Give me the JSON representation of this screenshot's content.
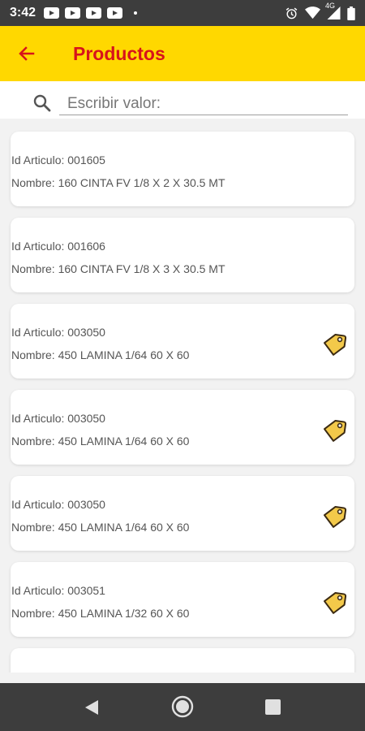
{
  "status_bar": {
    "time": "3:42",
    "network": "4G",
    "notification_icons": [
      "youtube-icon",
      "youtube-icon",
      "youtube-icon",
      "youtube-icon"
    ]
  },
  "app_bar": {
    "title": "Productos",
    "background_color": "#ffd800",
    "title_color": "#d7141b"
  },
  "search": {
    "placeholder": "Escribir valor:",
    "value": ""
  },
  "products": [
    {
      "id_label": "Id Articulo:  001605",
      "name_label": "Nombre: 160 CINTA FV 1/8 X 2 X 30.5 MT",
      "has_tag": false
    },
    {
      "id_label": "Id Articulo:  001606",
      "name_label": "Nombre: 160 CINTA FV 1/8 X 3 X 30.5 MT",
      "has_tag": false
    },
    {
      "id_label": "Id Articulo:  003050",
      "name_label": "Nombre: 450 LAMINA 1/64 60 X 60",
      "has_tag": true
    },
    {
      "id_label": "Id Articulo:  003050",
      "name_label": "Nombre: 450 LAMINA 1/64 60 X 60",
      "has_tag": true
    },
    {
      "id_label": "Id Articulo:  003050",
      "name_label": "Nombre: 450 LAMINA 1/64 60 X 60",
      "has_tag": true
    },
    {
      "id_label": "Id Articulo:  003051",
      "name_label": "Nombre: 450 LAMINA 1/32 60 X 60",
      "has_tag": true
    }
  ]
}
